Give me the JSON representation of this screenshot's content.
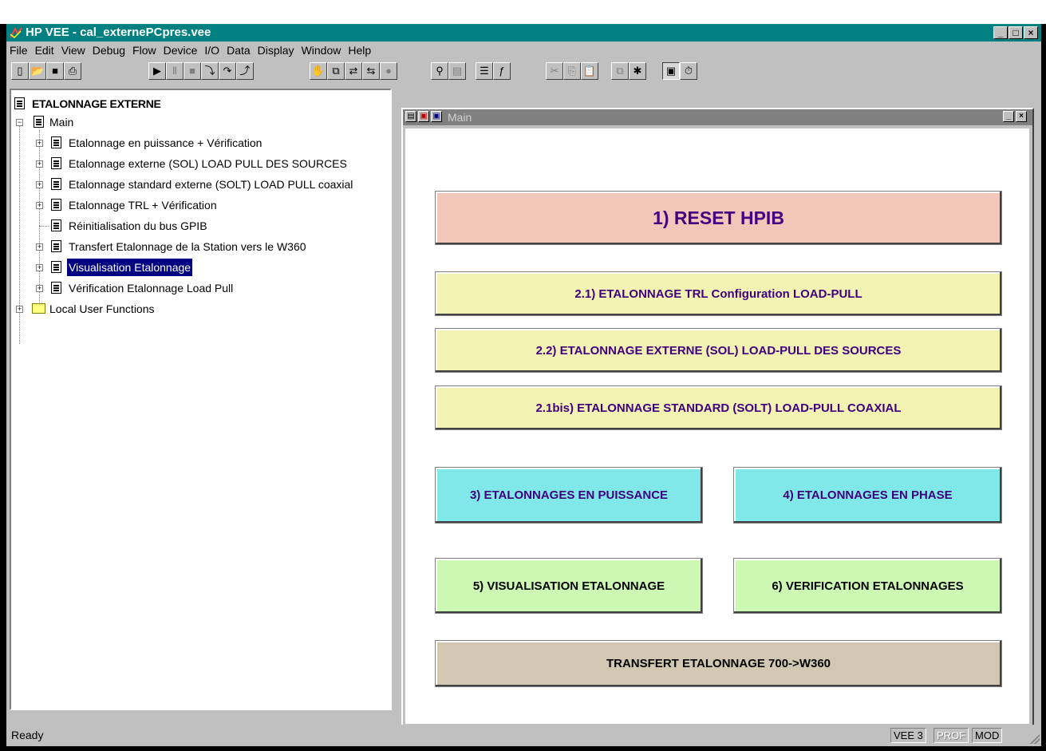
{
  "window": {
    "title": "HP VEE - cal_externePCpres.vee"
  },
  "menu": [
    "File",
    "Edit",
    "View",
    "Debug",
    "Flow",
    "Device",
    "I/O",
    "Data",
    "Display",
    "Window",
    "Help"
  ],
  "toolbar": {
    "groups": [
      [
        "new-icon",
        "open-icon",
        "save-icon",
        "print-icon"
      ],
      [
        "run-icon",
        "pause-icon",
        "stop-icon",
        "step-into-icon",
        "step-over-icon",
        "step-out-icon"
      ],
      [
        "hand-icon",
        "copy-object-icon",
        "move-icon",
        "connect-icon",
        "circle-icon"
      ],
      [
        "find-icon",
        "watch-icon",
        "properties-icon",
        "function-icon"
      ],
      [
        "cut-icon",
        "copy-icon",
        "paste-icon"
      ],
      [
        "clone-icon",
        "debug-icon",
        "panel-icon",
        "timer-icon"
      ]
    ]
  },
  "tree": {
    "root": "ETALONNAGE EXTERNE",
    "main": "Main",
    "items": [
      "Etalonnage en puissance + Vérification",
      "Etalonnage externe (SOL) LOAD PULL DES SOURCES",
      "Etalonnage standard externe (SOLT) LOAD PULL coaxial",
      "Etalonnage TRL + Vérification",
      "Réinitialisation du bus GPIB",
      "Transfert Etalonnage de la Station vers le W360",
      "Visualisation Etalonnage",
      "Vérification Etalonnage Load Pull"
    ],
    "selected_index": 6,
    "local": "Local User Functions"
  },
  "main_window": {
    "title": "Main"
  },
  "buttons": {
    "reset": "1) RESET HPIB",
    "trl": "2.1) ETALONNAGE TRL Configuration LOAD-PULL",
    "sol": "2.2) ETALONNAGE EXTERNE (SOL) LOAD-PULL DES SOURCES",
    "solt": "2.1bis) ETALONNAGE STANDARD (SOLT)  LOAD-PULL COAXIAL",
    "puissance": "3) ETALONNAGES EN PUISSANCE",
    "phase": "4) ETALONNAGES EN PHASE",
    "visualisation": "5) VISUALISATION ETALONNAGE",
    "verification": "6) VERIFICATION ETALONNAGES",
    "transfert": "TRANSFERT ETALONNAGE 700->W360"
  },
  "colors": {
    "reset": "#f2c6b8",
    "yellow": "#f2f2b2",
    "cyan": "#80e8e8",
    "green": "#ccf8b4",
    "tan": "#d2c8b2",
    "title_teal": "#008080"
  },
  "status": {
    "text": "Ready",
    "vee": "VEE 3",
    "prof": "PROF",
    "mod": "MOD"
  }
}
